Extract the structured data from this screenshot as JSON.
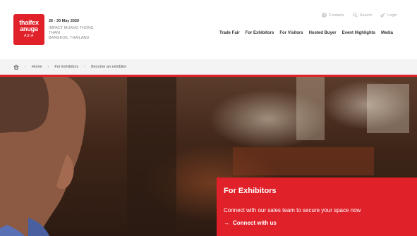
{
  "logo": {
    "line1": "thaifex",
    "line2": "anuga",
    "line3": "ASIA"
  },
  "event": {
    "dates": "26 - 30 May 2020",
    "venue_line1": "IMPACT MUANG THONG",
    "venue_line2": "THANI",
    "venue_line3": "BANGKOK, THAILAND"
  },
  "util_nav": [
    {
      "label": "Contacts",
      "icon": "globe-icon"
    },
    {
      "label": "Search",
      "icon": "search-icon"
    },
    {
      "label": "Login",
      "icon": "key-icon"
    }
  ],
  "main_nav": [
    "Trade Fair",
    "For Exhibitors",
    "For Visitors",
    "Hosted Buyer",
    "Event Highlights",
    "Media"
  ],
  "breadcrumb": {
    "home_icon": "home-icon",
    "items": [
      "Home",
      "For Exhibitors",
      "Become an exhibitor"
    ]
  },
  "hero": {
    "title": "For Exhibitors",
    "text": "Connect with our sales team to secure your space now",
    "link_label": "Connect with us",
    "link_arrow": "→"
  },
  "colors": {
    "brand_red": "#e0212a"
  }
}
